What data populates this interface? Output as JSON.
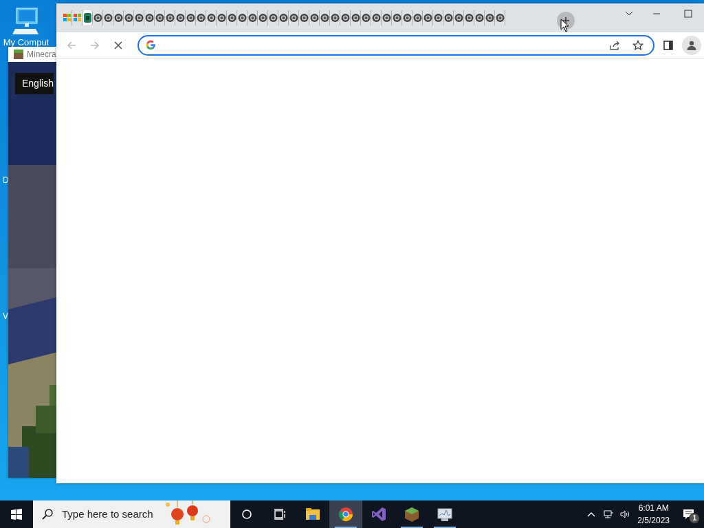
{
  "desktop": {
    "icons": [
      {
        "label": "My Comput",
        "kind": "computer"
      }
    ],
    "label_fragments": [
      "D",
      "V"
    ]
  },
  "minecraft_window": {
    "title": "Minecra",
    "language_button": "English"
  },
  "browser": {
    "tabs": [
      {
        "kind": "microsoft",
        "selected": false
      },
      {
        "kind": "microsoft",
        "selected": false
      },
      {
        "kind": "app",
        "selected": true
      },
      {
        "kind": "chrome",
        "selected": false
      },
      {
        "kind": "chrome",
        "selected": false
      },
      {
        "kind": "chrome",
        "selected": false
      },
      {
        "kind": "chrome",
        "selected": false
      },
      {
        "kind": "chrome",
        "selected": false
      },
      {
        "kind": "chrome",
        "selected": false
      },
      {
        "kind": "chrome",
        "selected": false
      },
      {
        "kind": "chrome",
        "selected": false
      },
      {
        "kind": "chrome",
        "selected": false
      },
      {
        "kind": "chrome",
        "selected": false
      },
      {
        "kind": "chrome",
        "selected": false
      },
      {
        "kind": "chrome",
        "selected": false
      },
      {
        "kind": "chrome",
        "selected": false
      },
      {
        "kind": "chrome",
        "selected": false
      },
      {
        "kind": "chrome",
        "selected": false
      },
      {
        "kind": "chrome",
        "selected": false
      },
      {
        "kind": "chrome",
        "selected": false
      },
      {
        "kind": "chrome",
        "selected": false
      },
      {
        "kind": "chrome",
        "selected": false
      },
      {
        "kind": "chrome",
        "selected": false
      },
      {
        "kind": "chrome",
        "selected": false
      },
      {
        "kind": "chrome",
        "selected": false
      },
      {
        "kind": "chrome",
        "selected": false
      },
      {
        "kind": "chrome",
        "selected": false
      },
      {
        "kind": "chrome",
        "selected": false
      },
      {
        "kind": "chrome",
        "selected": false
      },
      {
        "kind": "chrome",
        "selected": false
      },
      {
        "kind": "chrome",
        "selected": false
      },
      {
        "kind": "chrome",
        "selected": false
      },
      {
        "kind": "chrome",
        "selected": false
      },
      {
        "kind": "chrome",
        "selected": false
      },
      {
        "kind": "chrome",
        "selected": false
      },
      {
        "kind": "chrome",
        "selected": false
      },
      {
        "kind": "chrome",
        "selected": false
      },
      {
        "kind": "chrome",
        "selected": false
      },
      {
        "kind": "chrome",
        "selected": false
      },
      {
        "kind": "chrome",
        "selected": false
      },
      {
        "kind": "chrome",
        "selected": false
      },
      {
        "kind": "chrome",
        "selected": false
      },
      {
        "kind": "chrome",
        "selected": false
      }
    ],
    "back_disabled": true,
    "forward_disabled": true,
    "loading": true,
    "address": {
      "focused": true
    }
  },
  "taskbar": {
    "search_placeholder": "Type here to search",
    "apps": [
      {
        "kind": "explorer",
        "running": false,
        "active": false
      },
      {
        "kind": "chrome",
        "running": true,
        "active": true
      },
      {
        "kind": "visual-studio",
        "running": false,
        "active": false
      },
      {
        "kind": "minecraft",
        "running": true,
        "active": false
      },
      {
        "kind": "monitor",
        "running": true,
        "active": false
      }
    ],
    "time": "6:01 AM",
    "date": "2/5/2023",
    "notification_count": "1"
  }
}
